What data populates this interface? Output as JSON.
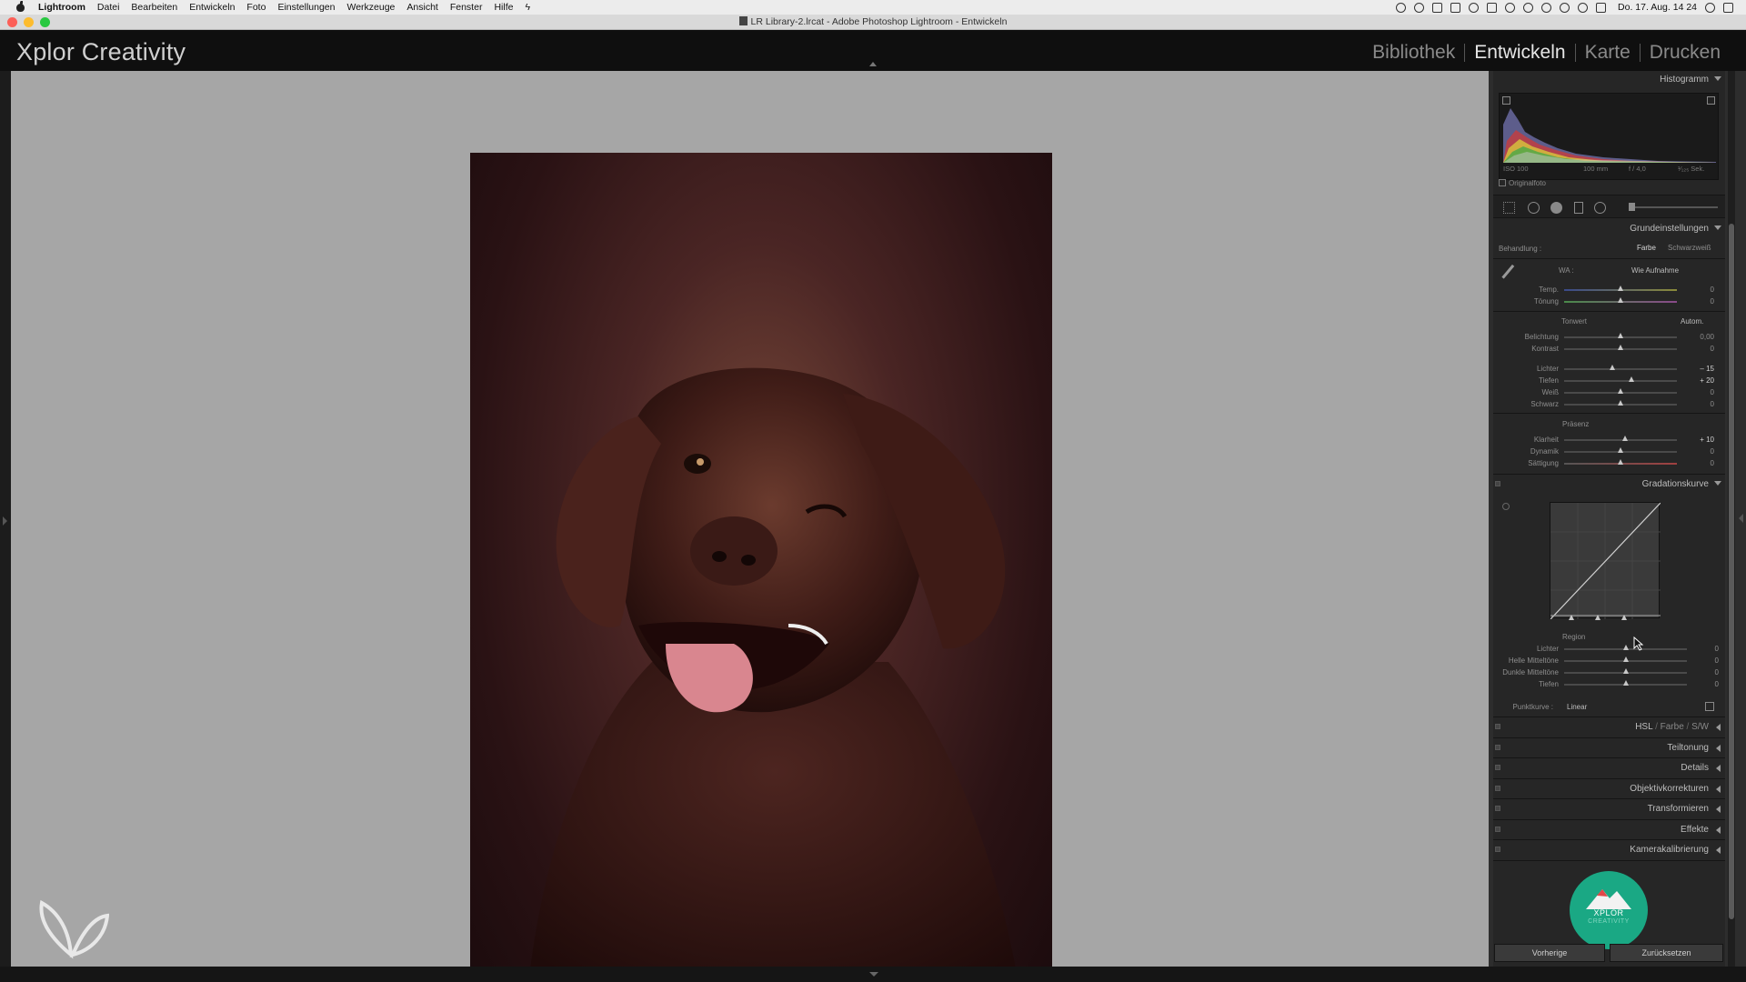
{
  "menubar": {
    "app": "Lightroom",
    "items": [
      "Datei",
      "Bearbeiten",
      "Entwickeln",
      "Foto",
      "Einstellungen",
      "Werkzeuge",
      "Ansicht",
      "Fenster",
      "Hilfe"
    ],
    "clock": "Do. 17. Aug. 14 24"
  },
  "window": {
    "title": "LR Library-2.lrcat - Adobe Photoshop Lightroom - Entwickeln"
  },
  "header": {
    "brand": "Xplor Creativity",
    "modules": [
      {
        "label": "Bibliothek",
        "active": false
      },
      {
        "label": "Entwickeln",
        "active": true
      },
      {
        "label": "Karte",
        "active": false
      },
      {
        "label": "Drucken",
        "active": false
      }
    ]
  },
  "histogram": {
    "title": "Histogramm",
    "iso": "ISO 100",
    "focal": "100 mm",
    "aperture": "f / 4,0",
    "shutter": "¹⁄₁₂₅ Sek.",
    "original_label": "Originalfoto"
  },
  "basic": {
    "title": "Grundeinstellungen",
    "treatment_label": "Behandlung :",
    "treatment_color": "Farbe",
    "treatment_bw": "Schwarzweiß",
    "wb_label": "WA :",
    "wb_value": "Wie Aufnahme",
    "temp_label": "Temp.",
    "temp_value": "0",
    "tint_label": "Tönung",
    "tint_value": "0",
    "tone_label": "Tonwert",
    "auto_label": "Autom.",
    "exposure_label": "Belichtung",
    "exposure_value": "0,00",
    "contrast_label": "Kontrast",
    "contrast_value": "0",
    "highlights_label": "Lichter",
    "highlights_value": "– 15",
    "shadows_label": "Tiefen",
    "shadows_value": "+ 20",
    "whites_label": "Weiß",
    "whites_value": "0",
    "blacks_label": "Schwarz",
    "blacks_value": "0",
    "presence_label": "Präsenz",
    "clarity_label": "Klarheit",
    "clarity_value": "+ 10",
    "vibrance_label": "Dynamik",
    "vibrance_value": "0",
    "saturation_label": "Sättigung",
    "saturation_value": "0"
  },
  "curve": {
    "title": "Gradationskurve",
    "region_label": "Region",
    "highlights_label": "Lichter",
    "highlights_value": "0",
    "lights_label": "Helle Mitteltöne",
    "lights_value": "0",
    "darks_label": "Dunkle Mitteltöne",
    "darks_value": "0",
    "shadows_label": "Tiefen",
    "shadows_value": "0",
    "point_curve_label": "Punktkurve :",
    "point_curve_value": "Linear"
  },
  "panels": {
    "hsl": "HSL",
    "hsl_color": "Farbe",
    "hsl_bw": "S/W",
    "split_toning": "Teiltonung",
    "details": "Details",
    "lens": "Objektivkorrekturen",
    "transform": "Transformieren",
    "effects": "Effekte",
    "calibration": "Kamerakalibrierung"
  },
  "logo": {
    "text": "XPLOR",
    "subtext": "CREATIVITY"
  },
  "footer": {
    "previous": "Vorherige",
    "reset": "Zurücksetzen"
  },
  "colors": {
    "accent_logo": "#1aa884",
    "canvas": "#a6a6a6",
    "panel": "#262626"
  }
}
